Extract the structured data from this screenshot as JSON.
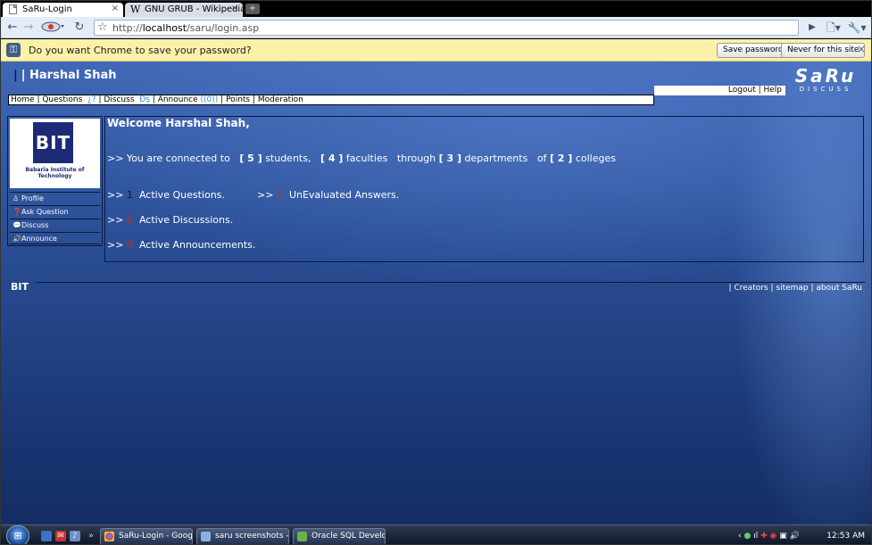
{
  "browser": {
    "tabs": [
      {
        "title": "SaRu-Login",
        "close": "×"
      },
      {
        "title": "GNU GRUB - Wikipedia, t...",
        "close": "×"
      }
    ],
    "new_tab": "+",
    "url_prefix": "http://",
    "url_host": "localhost",
    "url_path": "/saru/login.asp",
    "infobar": {
      "message": "Do you want Chrome to save your password?",
      "save_button": "Save password",
      "never_button": "Never for this site",
      "close": "×"
    }
  },
  "page": {
    "user_name": "Harshal Shah",
    "logo_big": "SaRu",
    "logo_small": "DISCUSS",
    "user_links": "Logout | Help",
    "nav": {
      "home": "Home",
      "sep": " | ",
      "questions": "Questions",
      "questions_badge": "¿?",
      "discuss": "Discuss",
      "discuss_badge": "Đş",
      "announce": "Announce",
      "announce_badge": "((0))",
      "points": "Points",
      "moderation": "Moderation"
    },
    "sidebar": {
      "college_logo_text": "BIT",
      "college_name": "Babaria Institute of Technology",
      "items": [
        {
          "label": "Profile"
        },
        {
          "label": "Ask Question"
        },
        {
          "label": "Discuss"
        },
        {
          "label": "Announce"
        }
      ]
    },
    "main": {
      "welcome": "Welcome Harshal Shah,",
      "connected_prefix": ">> You are connected to",
      "students_num": "[ 5 ]",
      "students_label": "students,",
      "faculties_num": "[ 4 ]",
      "faculties_label": "faculties",
      "through": "through",
      "departments_num": "[ 3 ]",
      "departments_label": "departments",
      "of": "of",
      "colleges_num": "[ 2 ]",
      "colleges_label": "colleges",
      "arrow": ">>",
      "active_questions_count": "1",
      "active_questions_label": "Active Questions.",
      "unevaluated_count": "1",
      "unevaluated_label": "UnEvaluated Answers.",
      "active_discussions_count": "0",
      "active_discussions_label": "Active Discussions.",
      "active_announcements_count": "0",
      "active_announcements_label": "Active Announcements."
    },
    "footer": {
      "logo": "BIT",
      "links": "| Creators | sitemap | about SaRu"
    }
  },
  "taskbar": {
    "chevron": "»",
    "buttons": [
      {
        "label": "SaRu-Login - Googl..."
      },
      {
        "label": "saru screenshots - ..."
      },
      {
        "label": "Oracle SQL Develop..."
      }
    ],
    "clock": "12:53 AM"
  }
}
